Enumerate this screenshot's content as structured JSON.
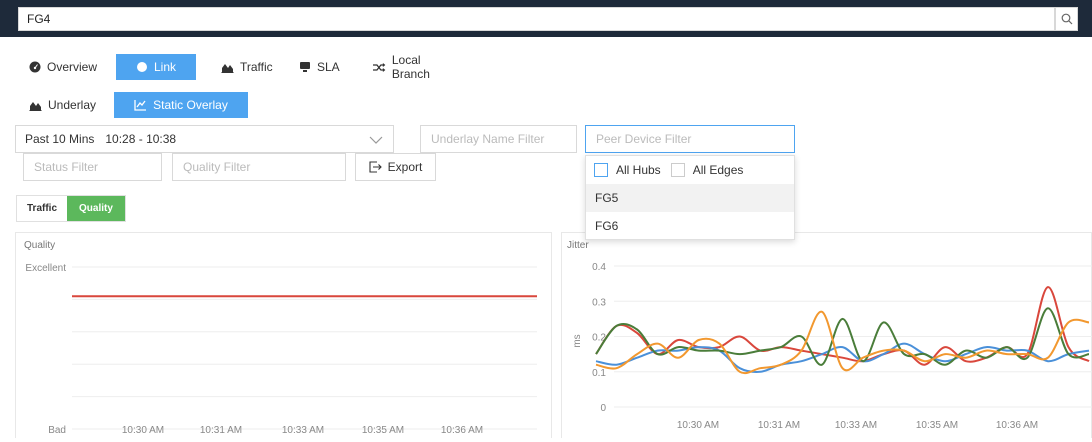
{
  "search": {
    "value": "FG4"
  },
  "main_tabs": [
    {
      "label": "Overview",
      "icon": "dashboard-icon",
      "active": false
    },
    {
      "label": "Link",
      "icon": "link-bubble-icon",
      "active": true
    },
    {
      "label": "Traffic",
      "icon": "area-chart-icon",
      "active": false
    },
    {
      "label": "SLA",
      "icon": "monitor-icon",
      "active": false
    },
    {
      "label": "Local Branch",
      "icon": "shuffle-icon",
      "active": false
    }
  ],
  "sub_tabs": [
    {
      "label": "Underlay",
      "icon": "area-chart-icon",
      "active": false
    },
    {
      "label": "Static Overlay",
      "icon": "line-chart-icon",
      "active": true
    }
  ],
  "filters": {
    "time_range_label": "Past 10 Mins",
    "time_range_value": "10:28 - 10:38",
    "underlay_placeholder": "Underlay Name Filter",
    "peer_device_placeholder": "Peer Device Filter",
    "status_placeholder": "Status Filter",
    "quality_placeholder": "Quality Filter",
    "export_label": "Export"
  },
  "peer_dropdown": {
    "checkboxes": [
      "All Hubs",
      "All Edges"
    ],
    "items": [
      "FG5",
      "FG6"
    ]
  },
  "metric_toggle": {
    "traffic": "Traffic",
    "quality": "Quality",
    "active": "Quality"
  },
  "colors": {
    "accent": "#4ea4f0",
    "green_toggle": "#5cb85c",
    "series_red": "#d9473c",
    "series_blue": "#4a90d9",
    "series_green": "#4a7d3a",
    "series_orange": "#f2982f"
  },
  "chart_data": [
    {
      "type": "line",
      "ylabel": "Quality",
      "y_categories": [
        "Bad",
        "Excellent"
      ],
      "x_ticks": [
        "10:30 AM",
        "10:31 AM",
        "10:33 AM",
        "10:35 AM",
        "10:36 AM"
      ],
      "series": [
        {
          "color": "#d9473c",
          "values": [
            0.82,
            0.82,
            0.82,
            0.82,
            0.82,
            0.82,
            0.82
          ]
        }
      ]
    },
    {
      "type": "line",
      "ylabel": "Jitter",
      "yunit": "ms",
      "ylim": [
        0,
        0.4
      ],
      "y_ticks": [
        "0",
        "0.1",
        "0.2",
        "0.3",
        "0.4"
      ],
      "x_ticks": [
        "10:30 AM",
        "10:31 AM",
        "10:33 AM",
        "10:35 AM",
        "10:36 AM"
      ],
      "x": [
        0,
        0.5,
        1,
        1.5,
        2,
        2.5,
        3,
        3.5,
        4,
        4.5,
        5,
        5.5,
        6,
        6.5,
        7,
        7.5,
        8,
        8.5,
        9,
        9.5,
        10,
        10.5,
        11,
        11.5,
        12
      ],
      "series": [
        {
          "color": "#d9473c",
          "values": [
            0.15,
            0.23,
            0.21,
            0.15,
            0.19,
            0.17,
            0.17,
            0.2,
            0.16,
            0.17,
            0.16,
            0.15,
            0.14,
            0.13,
            0.15,
            0.16,
            0.12,
            0.17,
            0.13,
            0.14,
            0.17,
            0.15,
            0.34,
            0.17,
            0.13
          ]
        },
        {
          "color": "#4a90d9",
          "values": [
            0.13,
            0.12,
            0.14,
            0.16,
            0.16,
            0.17,
            0.16,
            0.11,
            0.1,
            0.12,
            0.13,
            0.15,
            0.17,
            0.13,
            0.15,
            0.18,
            0.15,
            0.13,
            0.15,
            0.17,
            0.16,
            0.16,
            0.13,
            0.15,
            0.16
          ]
        },
        {
          "color": "#4a7d3a",
          "values": [
            0.15,
            0.23,
            0.22,
            0.15,
            0.17,
            0.16,
            0.16,
            0.15,
            0.16,
            0.17,
            0.2,
            0.12,
            0.25,
            0.13,
            0.24,
            0.15,
            0.15,
            0.12,
            0.16,
            0.14,
            0.17,
            0.14,
            0.28,
            0.15,
            0.15
          ]
        },
        {
          "color": "#f2982f",
          "values": [
            0.12,
            0.11,
            0.15,
            0.18,
            0.14,
            0.19,
            0.18,
            0.1,
            0.11,
            0.12,
            0.16,
            0.27,
            0.11,
            0.14,
            0.16,
            0.16,
            0.13,
            0.15,
            0.14,
            0.16,
            0.15,
            0.15,
            0.14,
            0.24,
            0.24
          ]
        }
      ]
    }
  ]
}
